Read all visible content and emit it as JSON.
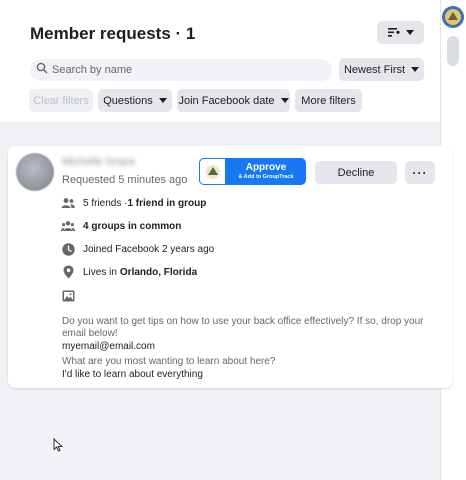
{
  "header": {
    "title": "Member requests · 1",
    "search_placeholder": "Search by name",
    "sort_label": "Newest First"
  },
  "filters": {
    "clear": "Clear filters",
    "questions": "Questions",
    "join_date": "Join Facebook date",
    "more": "More filters"
  },
  "request": {
    "name": "Michelle Grace",
    "requested": "Requested 5 minutes ago",
    "approve_label": "Approve",
    "approve_sub": "& Add to GroupTrack",
    "decline_label": "Decline",
    "more_label": "···",
    "friends_a": "5 friends · ",
    "friends_b": "1 friend in group",
    "groups": "4 groups in common",
    "joined": "Joined Facebook 2 years ago",
    "lives_prefix": "Lives in ",
    "lives_city": "Orlando, Florida",
    "q1": "Do you want to get tips on how to use your back office effectively? If so, drop your email below!",
    "a1": "myemail@email.com",
    "q2": "What are you most wanting to learn about here?",
    "a2": "I'd like to learn about everything"
  },
  "colors": {
    "accent": "#1877f2",
    "button_gray": "#e4e6eb",
    "page_bg": "#f0f2f5",
    "secondary_text": "#65676b"
  }
}
